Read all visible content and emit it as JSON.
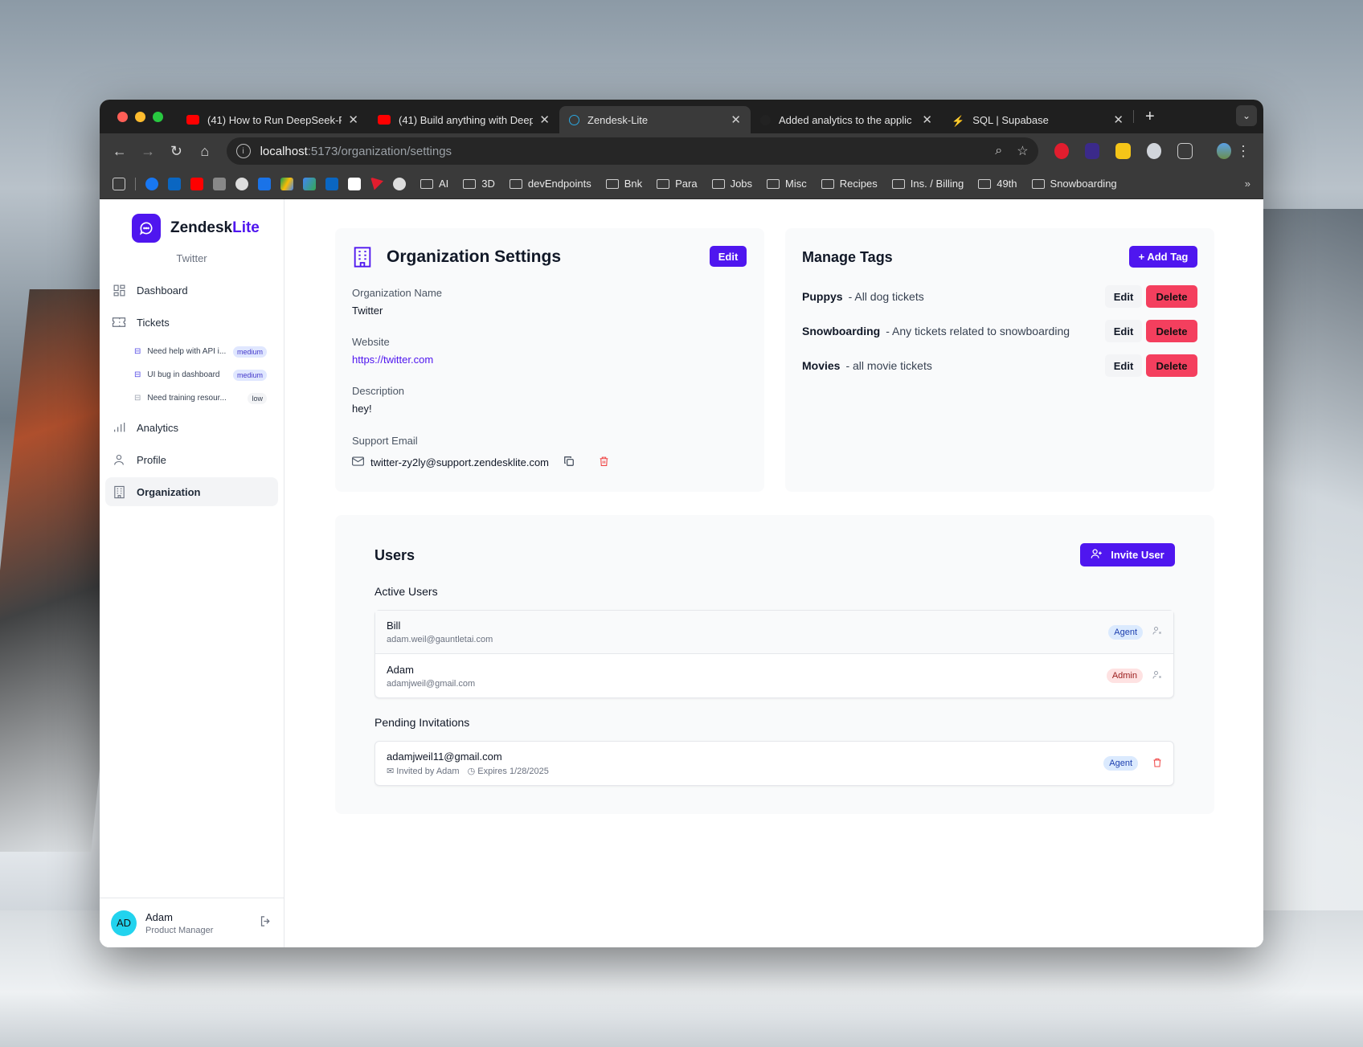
{
  "browser": {
    "tabs": [
      {
        "title": "(41) How to Run DeepSeek-R",
        "favicon_color": "#ff0000"
      },
      {
        "title": "(41) Build anything with Deep",
        "favicon_color": "#ff0000"
      },
      {
        "title": "Zendesk-Lite",
        "favicon_color": "#2aa7e0"
      },
      {
        "title": "Added analytics to the applic",
        "favicon_color": "#222222"
      },
      {
        "title": "SQL | Supabase",
        "favicon_color": "#3ecf8e"
      }
    ],
    "url_host": "localhost",
    "url_path": ":5173/organization/settings",
    "bookmarks": [
      "AI",
      "3D",
      "devEndpoints",
      "Bnk",
      "Para",
      "Jobs",
      "Misc",
      "Recipes",
      "Ins. / Billing",
      "49th",
      "Snowboarding"
    ]
  },
  "sidebar": {
    "brand_main": "Zendesk",
    "brand_accent": "Lite",
    "org_name": "Twitter",
    "nav": {
      "dashboard": "Dashboard",
      "tickets": "Tickets",
      "analytics": "Analytics",
      "profile": "Profile",
      "organization": "Organization"
    },
    "tickets": [
      {
        "title": "Need help with API i...",
        "priority": "medium"
      },
      {
        "title": "UI bug in dashboard",
        "priority": "medium"
      },
      {
        "title": "Need training resour...",
        "priority": "low"
      }
    ],
    "user": {
      "initials": "AD",
      "name": "Adam",
      "role": "Product Manager"
    }
  },
  "org_settings": {
    "title": "Organization Settings",
    "edit_label": "Edit",
    "name_label": "Organization Name",
    "name_value": "Twitter",
    "website_label": "Website",
    "website_value": "https://twitter.com",
    "description_label": "Description",
    "description_value": "hey!",
    "support_label": "Support Email",
    "support_value": "twitter-zy2ly@support.zendesklite.com"
  },
  "tags": {
    "title": "Manage Tags",
    "add_label": "+ Add Tag",
    "edit_label": "Edit",
    "delete_label": "Delete",
    "items": [
      {
        "name": "Puppys",
        "desc": "- All dog tickets"
      },
      {
        "name": "Snowboarding",
        "desc": "- Any tickets related to snowboarding"
      },
      {
        "name": "Movies",
        "desc": "- all movie tickets"
      }
    ]
  },
  "users": {
    "title": "Users",
    "invite_label": "Invite User",
    "active_heading": "Active Users",
    "active": [
      {
        "name": "Bill",
        "email": "adam.weil@gauntletai.com",
        "role": "Agent"
      },
      {
        "name": "Adam",
        "email": "adamjweil@gmail.com",
        "role": "Admin"
      }
    ],
    "pending_heading": "Pending Invitations",
    "pending": [
      {
        "email": "adamjweil11@gmail.com",
        "invited_by": "Invited by Adam",
        "expires": "Expires 1/28/2025",
        "role": "Agent"
      }
    ]
  },
  "colors": {
    "accent": "#4f16ef",
    "danger": "#f43f5e",
    "avatar": "#22d3ee"
  }
}
